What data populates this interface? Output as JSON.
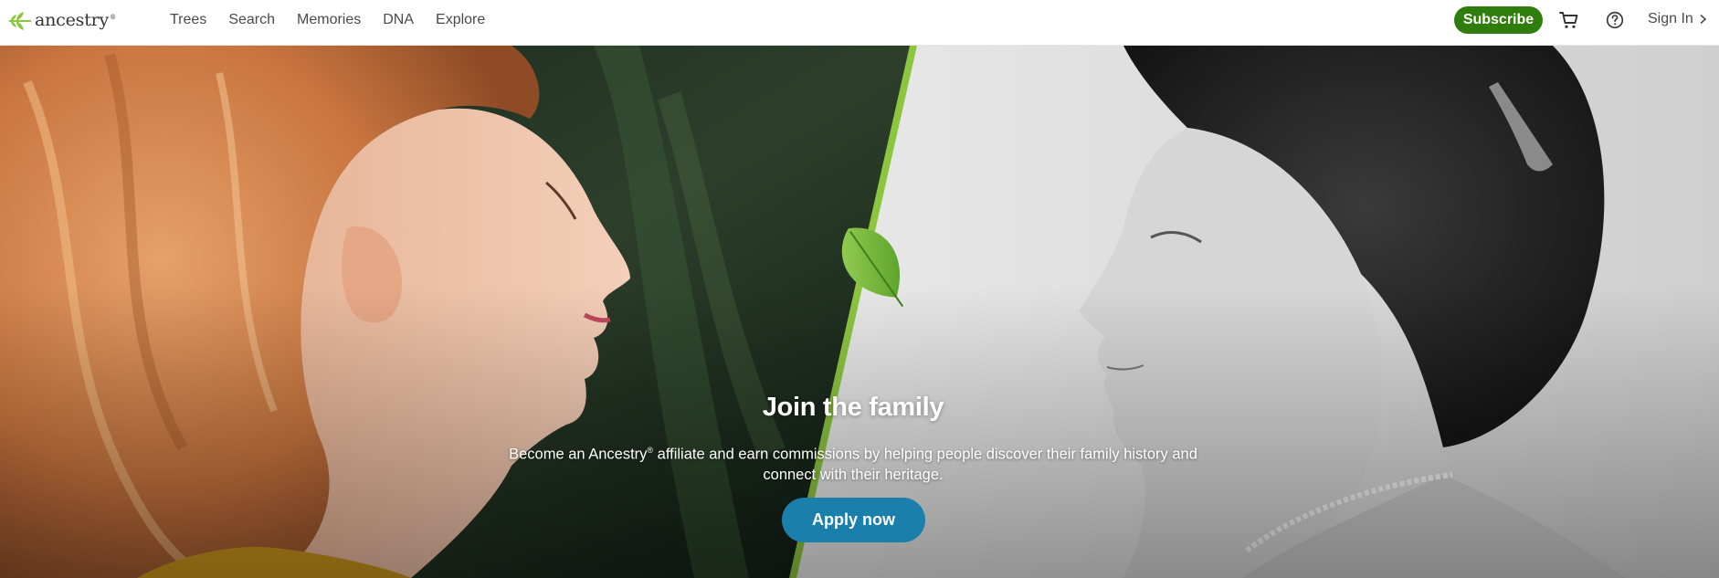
{
  "header": {
    "logo_text": "ancestry",
    "logo_tm": "®",
    "nav": [
      {
        "label": "Trees"
      },
      {
        "label": "Search"
      },
      {
        "label": "Memories"
      },
      {
        "label": "DNA"
      },
      {
        "label": "Explore"
      }
    ],
    "subscribe_label": "Subscribe",
    "cart_icon": "cart-icon",
    "help_icon": "help-circle-icon",
    "signin_label": "Sign In"
  },
  "hero": {
    "headline": "Join the family",
    "sub_before": "Become an Ancestry",
    "sub_reg": "®",
    "sub_after": " affiliate and earn commissions by helping people discover their family history and connect with their heritage.",
    "cta_label": "Apply now"
  },
  "colors": {
    "brand_green": "#2f7d0c",
    "cta_blue": "#1a7fab",
    "leaf_green": "#8cc63f"
  }
}
